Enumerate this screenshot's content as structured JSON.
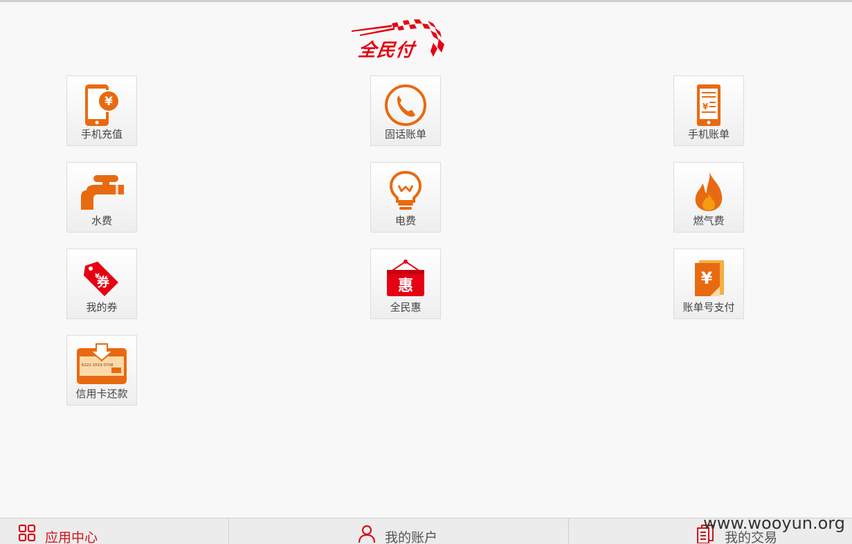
{
  "app": {
    "logo_text": "全民付"
  },
  "tiles": [
    {
      "label": "手机充值",
      "icon": "phone-recharge-icon"
    },
    {
      "label": "固话账单",
      "icon": "landline-bill-icon"
    },
    {
      "label": "手机账单",
      "icon": "mobile-bill-icon"
    },
    {
      "label": "水费",
      "icon": "water-faucet-icon"
    },
    {
      "label": "电费",
      "icon": "light-bulb-icon"
    },
    {
      "label": "燃气费",
      "icon": "gas-flame-icon"
    },
    {
      "label": "我的券",
      "icon": "coupon-tag-icon"
    },
    {
      "label": "全民惠",
      "icon": "hanging-sign-icon",
      "icon_text": "惠"
    },
    {
      "label": "账单号支付",
      "icon": "bill-number-icon"
    },
    {
      "label": "信用卡还款",
      "icon": "credit-card-icon",
      "card_number": "6222 2019 0708"
    }
  ],
  "bottom_nav": {
    "items": [
      {
        "label": "应用中心",
        "icon": "grid-icon",
        "active": true
      },
      {
        "label": "我的账户",
        "icon": "user-icon",
        "active": false
      },
      {
        "label": "我的交易",
        "icon": "document-icon",
        "active": false
      }
    ]
  },
  "watermark": "www.wooyun.org",
  "colors": {
    "brand_red": "#e60012",
    "icon_orange": "#e86a10",
    "active_nav": "#d0121b",
    "inactive_nav": "#555555",
    "background": "#f8f8f8"
  }
}
